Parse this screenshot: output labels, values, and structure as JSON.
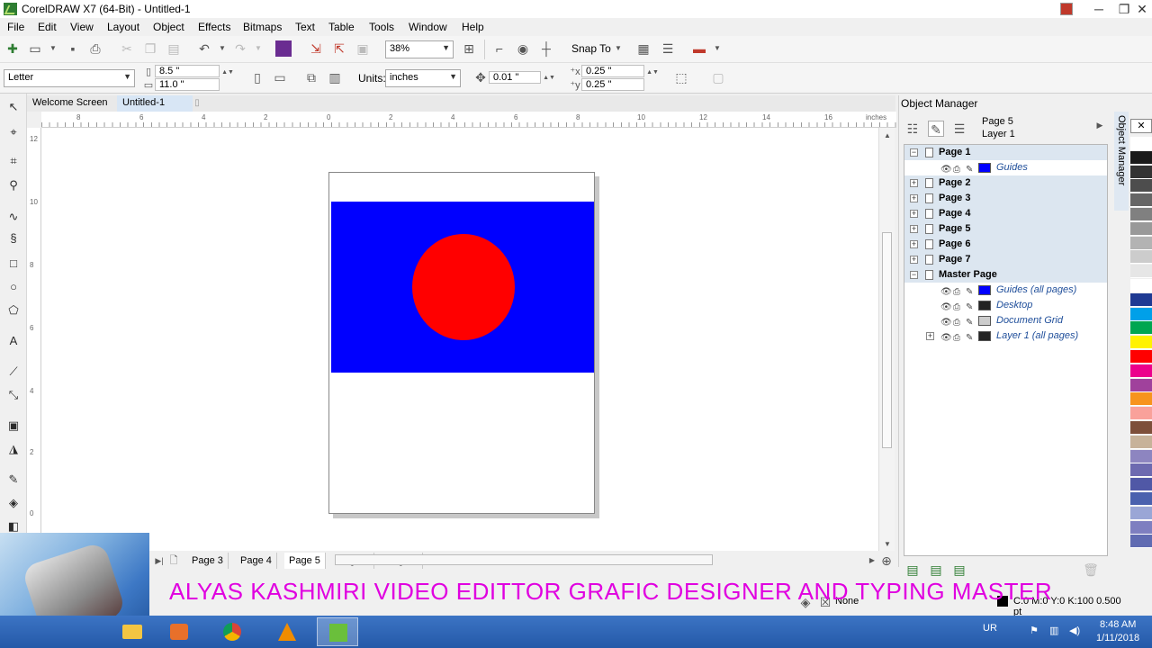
{
  "window": {
    "title": "CorelDRAW X7 (64-Bit) - Untitled-1",
    "minimize": "─",
    "restore": "❐",
    "close": "✕"
  },
  "menu": [
    "File",
    "Edit",
    "View",
    "Layout",
    "Object",
    "Effects",
    "Bitmaps",
    "Text",
    "Table",
    "Tools",
    "Window",
    "Help"
  ],
  "toolbar": {
    "zoom": "38%",
    "snap_to": "Snap To"
  },
  "property_bar": {
    "paper": "Letter",
    "width": "8.5 \"",
    "height": "11.0 \"",
    "units_label": "Units:",
    "units": "inches",
    "nudge": "0.01 \"",
    "dup_x": "0.25 \"",
    "dup_y": "0.25 \""
  },
  "doc_tabs": [
    "Welcome Screen",
    "Untitled-1"
  ],
  "ruler": {
    "unit": "inches",
    "h_labels": [
      "8",
      "6",
      "4",
      "2",
      "0",
      "2",
      "4",
      "6",
      "8",
      "10",
      "12",
      "14",
      "16"
    ],
    "v_labels": [
      "12",
      "10",
      "8",
      "6",
      "4",
      "2",
      "0"
    ]
  },
  "canvas": {
    "rect_color": "#0000ff",
    "circle_color": "#ff0000"
  },
  "page_tabs": [
    "Page 3",
    "Page 4",
    "Page 5",
    "Page 6",
    "Page 7"
  ],
  "object_manager": {
    "title": "Object Manager",
    "current_page": "Page 5",
    "current_layer": "Layer 1",
    "side_tab": "Object Manager",
    "rows": [
      {
        "kind": "page",
        "label": "Page 1",
        "exp": "−"
      },
      {
        "kind": "layer",
        "label": "Guides",
        "swatch": "#0000ff"
      },
      {
        "kind": "page",
        "label": "Page 2",
        "exp": "+"
      },
      {
        "kind": "page",
        "label": "Page 3",
        "exp": "+"
      },
      {
        "kind": "page",
        "label": "Page 4",
        "exp": "+"
      },
      {
        "kind": "page",
        "label": "Page 5",
        "exp": "+"
      },
      {
        "kind": "page",
        "label": "Page 6",
        "exp": "+"
      },
      {
        "kind": "page",
        "label": "Page 7",
        "exp": "+"
      },
      {
        "kind": "page",
        "label": "Master Page",
        "exp": "−"
      },
      {
        "kind": "layer",
        "label": "Guides (all pages)",
        "swatch": "#0000ff"
      },
      {
        "kind": "layer",
        "label": "Desktop",
        "swatch": "#222222"
      },
      {
        "kind": "layer",
        "label": "Document Grid",
        "swatch": "#cccccc"
      },
      {
        "kind": "layer",
        "label": "Layer 1 (all pages)",
        "swatch": "#222222",
        "exp": "+"
      }
    ]
  },
  "palette": [
    "#ffffff",
    "#1a1a1a",
    "#333333",
    "#4d4d4d",
    "#666666",
    "#808080",
    "#999999",
    "#b3b3b3",
    "#cccccc",
    "#e6e6e6",
    "#ffffff",
    "#1f3a93",
    "#00a0e9",
    "#00a651",
    "#fff200",
    "#ff0000",
    "#ec008c",
    "#a0419c",
    "#f7941d",
    "#f9a19a",
    "#7d4f3a",
    "#c7b299",
    "#8d85c0",
    "#6d6ab0",
    "#5058a6",
    "#4a61ae",
    "#9aa6d6",
    "#7e7fc0",
    "#606bb2"
  ],
  "status": {
    "fill": "None",
    "outline": "C:0 M:0 Y:0 K:100  0.500 pt"
  },
  "overlay_text": "ALYAS KASHMIRI VIDEO EDITTOR GRAFIC DESIGNER AND TYPING MASTER",
  "taskbar": {
    "lang": "UR",
    "time": "8:48 AM",
    "date": "1/11/2018"
  }
}
